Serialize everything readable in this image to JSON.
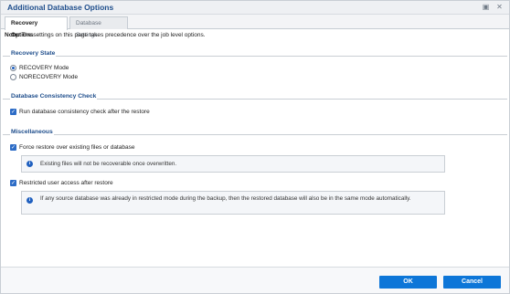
{
  "window": {
    "title": "Additional Database Options",
    "icons": [
      "restore-window-icon",
      "close-icon"
    ]
  },
  "tabs": [
    {
      "label": "Recovery Options",
      "active": true
    },
    {
      "label": "Database Settings",
      "active": false
    }
  ],
  "note": {
    "prefix": "Note:",
    "text": "The settings on this page takes precedence over the job level options."
  },
  "recovery_state": {
    "title": "Recovery State",
    "options": [
      {
        "label": "RECOVERY Mode",
        "selected": true
      },
      {
        "label": "NORECOVERY Mode",
        "selected": false
      }
    ]
  },
  "consistency_check": {
    "title": "Database Consistency Check",
    "run_check_label": "Run database consistency check after the restore",
    "run_check_checked": true
  },
  "miscellaneous": {
    "title": "Miscellaneous",
    "force_restore_label": "Force restore over existing files or database",
    "force_restore_checked": true,
    "force_restore_info": "Existing files will not be recoverable once overwritten.",
    "restricted_label": "Restricted user access after restore",
    "restricted_checked": true,
    "restricted_info": "If any source database was already in restricted mode during the backup, then the restored database will also be in the same mode automatically."
  },
  "footer": {
    "ok_label": "OK",
    "cancel_label": "Cancel"
  },
  "colors": {
    "accent": "#1f4e8c",
    "button": "#0d76d8"
  }
}
